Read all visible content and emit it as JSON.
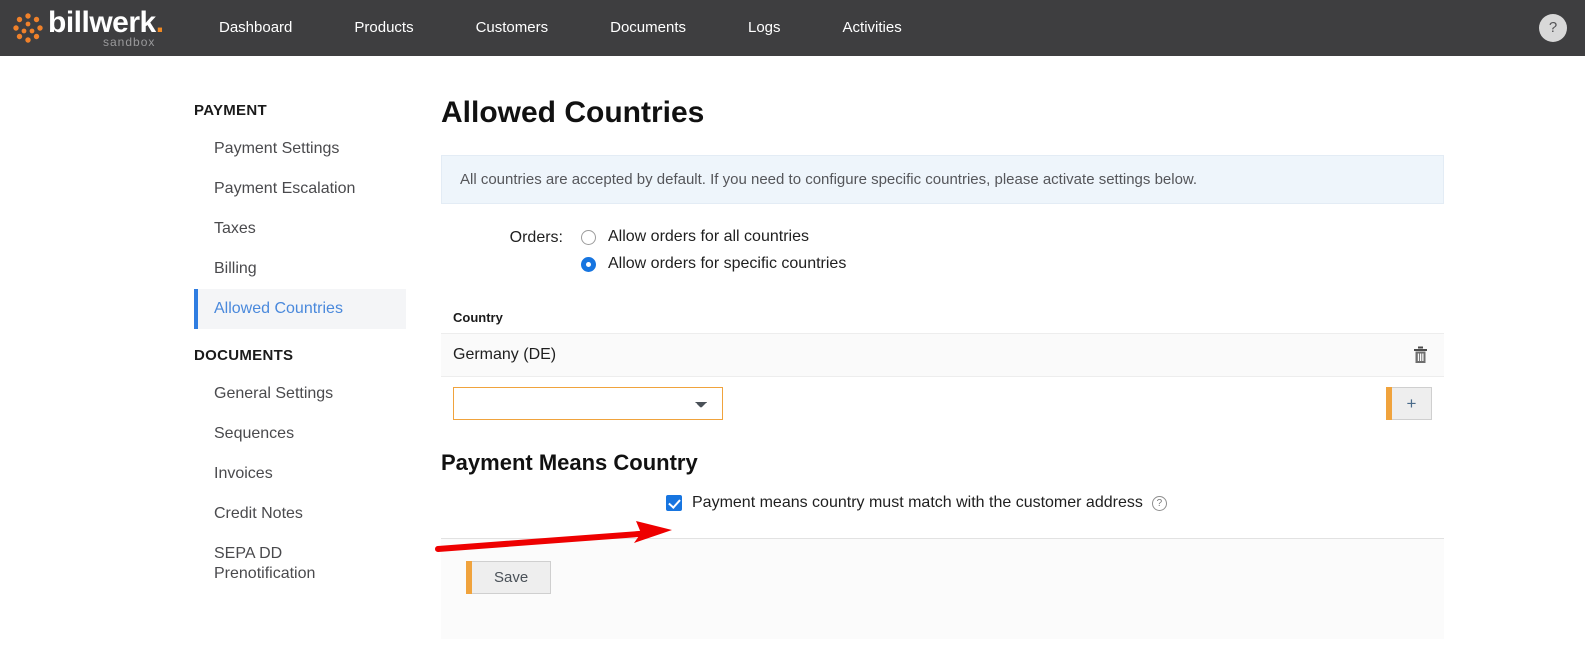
{
  "header": {
    "logo": {
      "word": "billwerk",
      "dot": ".",
      "sub": "sandbox"
    },
    "nav": [
      {
        "label": "Dashboard"
      },
      {
        "label": "Products"
      },
      {
        "label": "Customers"
      },
      {
        "label": "Documents"
      },
      {
        "label": "Logs"
      },
      {
        "label": "Activities"
      }
    ],
    "help_label": "?"
  },
  "sidebar": {
    "groups": [
      {
        "title": "PAYMENT",
        "items": [
          {
            "label": "Payment Settings",
            "active": false
          },
          {
            "label": "Payment Escalation",
            "active": false
          },
          {
            "label": "Taxes",
            "active": false
          },
          {
            "label": "Billing",
            "active": false
          },
          {
            "label": "Allowed Countries",
            "active": true
          }
        ]
      },
      {
        "title": "DOCUMENTS",
        "items": [
          {
            "label": "General Settings",
            "active": false
          },
          {
            "label": "Sequences",
            "active": false
          },
          {
            "label": "Invoices",
            "active": false
          },
          {
            "label": "Credit Notes",
            "active": false
          },
          {
            "label": "SEPA DD Prenotification",
            "active": false
          }
        ]
      }
    ]
  },
  "main": {
    "title": "Allowed Countries",
    "info_banner": "All countries are accepted by default. If you need to configure specific countries, please activate settings below.",
    "orders": {
      "label": "Orders:",
      "options": [
        {
          "label": "Allow orders for all countries",
          "selected": false
        },
        {
          "label": "Allow orders for specific countries",
          "selected": true
        }
      ]
    },
    "country_table": {
      "column_header": "Country",
      "rows": [
        {
          "name": "Germany (DE)",
          "delete_icon": "trash-icon"
        }
      ],
      "add_select_value": "",
      "add_select_options": [],
      "add_button_label": "+"
    },
    "payment_means": {
      "title": "Payment Means Country",
      "checkbox_label": "Payment means country must match with the customer address",
      "checkbox_checked": true,
      "help_icon": "?"
    },
    "save_label": "Save"
  },
  "annotation": {
    "arrow_color": "#ee0000",
    "arrow_target": "payment-means-checkbox"
  },
  "colors": {
    "header_bg": "#3e3e40",
    "accent_orange": "#f0a33d",
    "accent_blue": "#1775e0",
    "active_link": "#4a89dc",
    "banner_bg": "#eef5fb"
  }
}
